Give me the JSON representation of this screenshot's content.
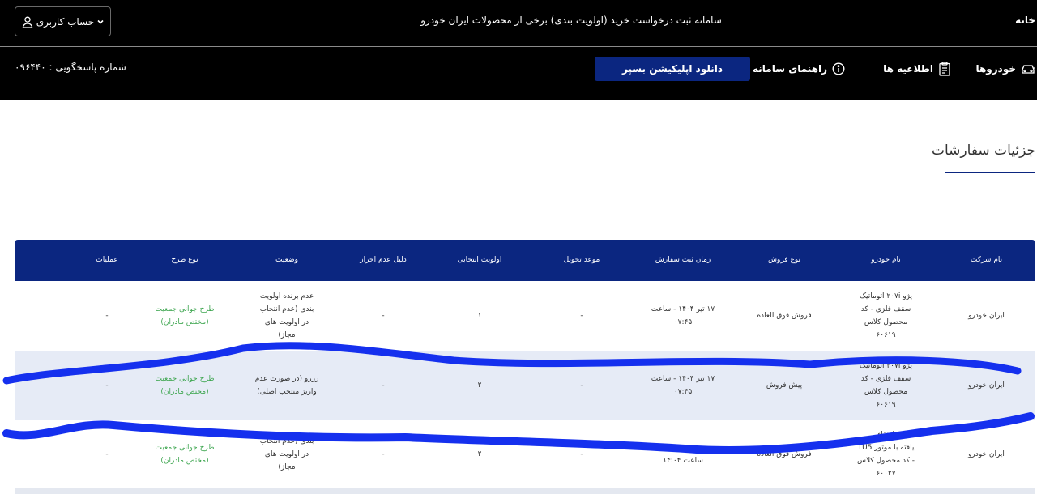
{
  "header": {
    "home": "خانه",
    "title": "سامانه ثبت درخواست خرید (اولویت بندی) برخی از محصولات ایران خودرو",
    "account": "حساب کاربری"
  },
  "nav": {
    "cars": "خودروها",
    "announcements": "اطلاعیه ها",
    "guide": "راهنمای سامانه",
    "download": "دانلود اپلیکیشن بسپر",
    "support": "شماره پاسخگویی : ۰۹۶۴۴۰"
  },
  "page": {
    "title": "جزئیات سفارشات"
  },
  "table": {
    "headers": [
      "نام شرکت",
      "نام خودرو",
      "نوع فروش",
      "زمان ثبت سفارش",
      "موعد تحویل",
      "اولویت انتخابی",
      "دلیل عدم احراز",
      "وضعیت",
      "نوع طرح",
      "عملیات"
    ],
    "rows": [
      {
        "company": "ایران خودرو",
        "car": [
          "پژو ۲۰۷i اتوماتیک",
          "سقف فلزی - کد",
          "محصول کلاس",
          "۶۰۶۱۹"
        ],
        "sale_type": "فروش فوق العاده",
        "order_time": [
          "۱۷ تیر ۱۴۰۴ - ساعت",
          "۰۷:۴۵"
        ],
        "delivery": "-",
        "priority": "۱",
        "reason": "-",
        "status": [
          "عدم برنده اولویت",
          "بندی (عدم انتخاب",
          "در اولویت های",
          "مجاز)"
        ],
        "plan": [
          "طرح جوانی جمعیت",
          "(مختص مادران)"
        ],
        "actions": "-"
      },
      {
        "company": "ایران خودرو",
        "car": [
          "پژو ۲۰۷i اتوماتیک",
          "سقف فلزی - کد",
          "محصول کلاس",
          "۶۰۶۱۹"
        ],
        "sale_type": "پیش فروش",
        "order_time": [
          "۱۷ تیر ۱۴۰۴ - ساعت",
          "۰۷:۴۵"
        ],
        "delivery": "-",
        "priority": "۲",
        "reason": "-",
        "status": [
          "رزرو (در صورت عدم",
          "واریز منتخب اصلی)"
        ],
        "plan": [
          "طرح جوانی جمعیت",
          "(مختص مادران)"
        ],
        "actions": "-"
      },
      {
        "company": "ایران خودرو",
        "car": [
          "ارتقاء",
          "یافته با موتور TU5",
          "- کد محصول کلاس",
          "۶۰۰۲۷"
        ],
        "sale_type": "فروش فوق العاده",
        "order_time": [
          "۱۴۰۴",
          "ساعت ۱۴:۰۴"
        ],
        "delivery": "-",
        "priority": "۲",
        "reason": "-",
        "status": [
          "بندی (عدم انتخاب",
          "در اولویت های",
          "مجاز)"
        ],
        "plan": [
          "طرح جوانی جمعیت",
          "(مختص مادران)"
        ],
        "actions": "-"
      }
    ]
  },
  "colors": {
    "header_bg": "#000000",
    "brand_blue": "#0b2680",
    "highlight_row": "#e6ebf6",
    "plan_green": "#3ea650",
    "scribble": "#1530ee"
  }
}
